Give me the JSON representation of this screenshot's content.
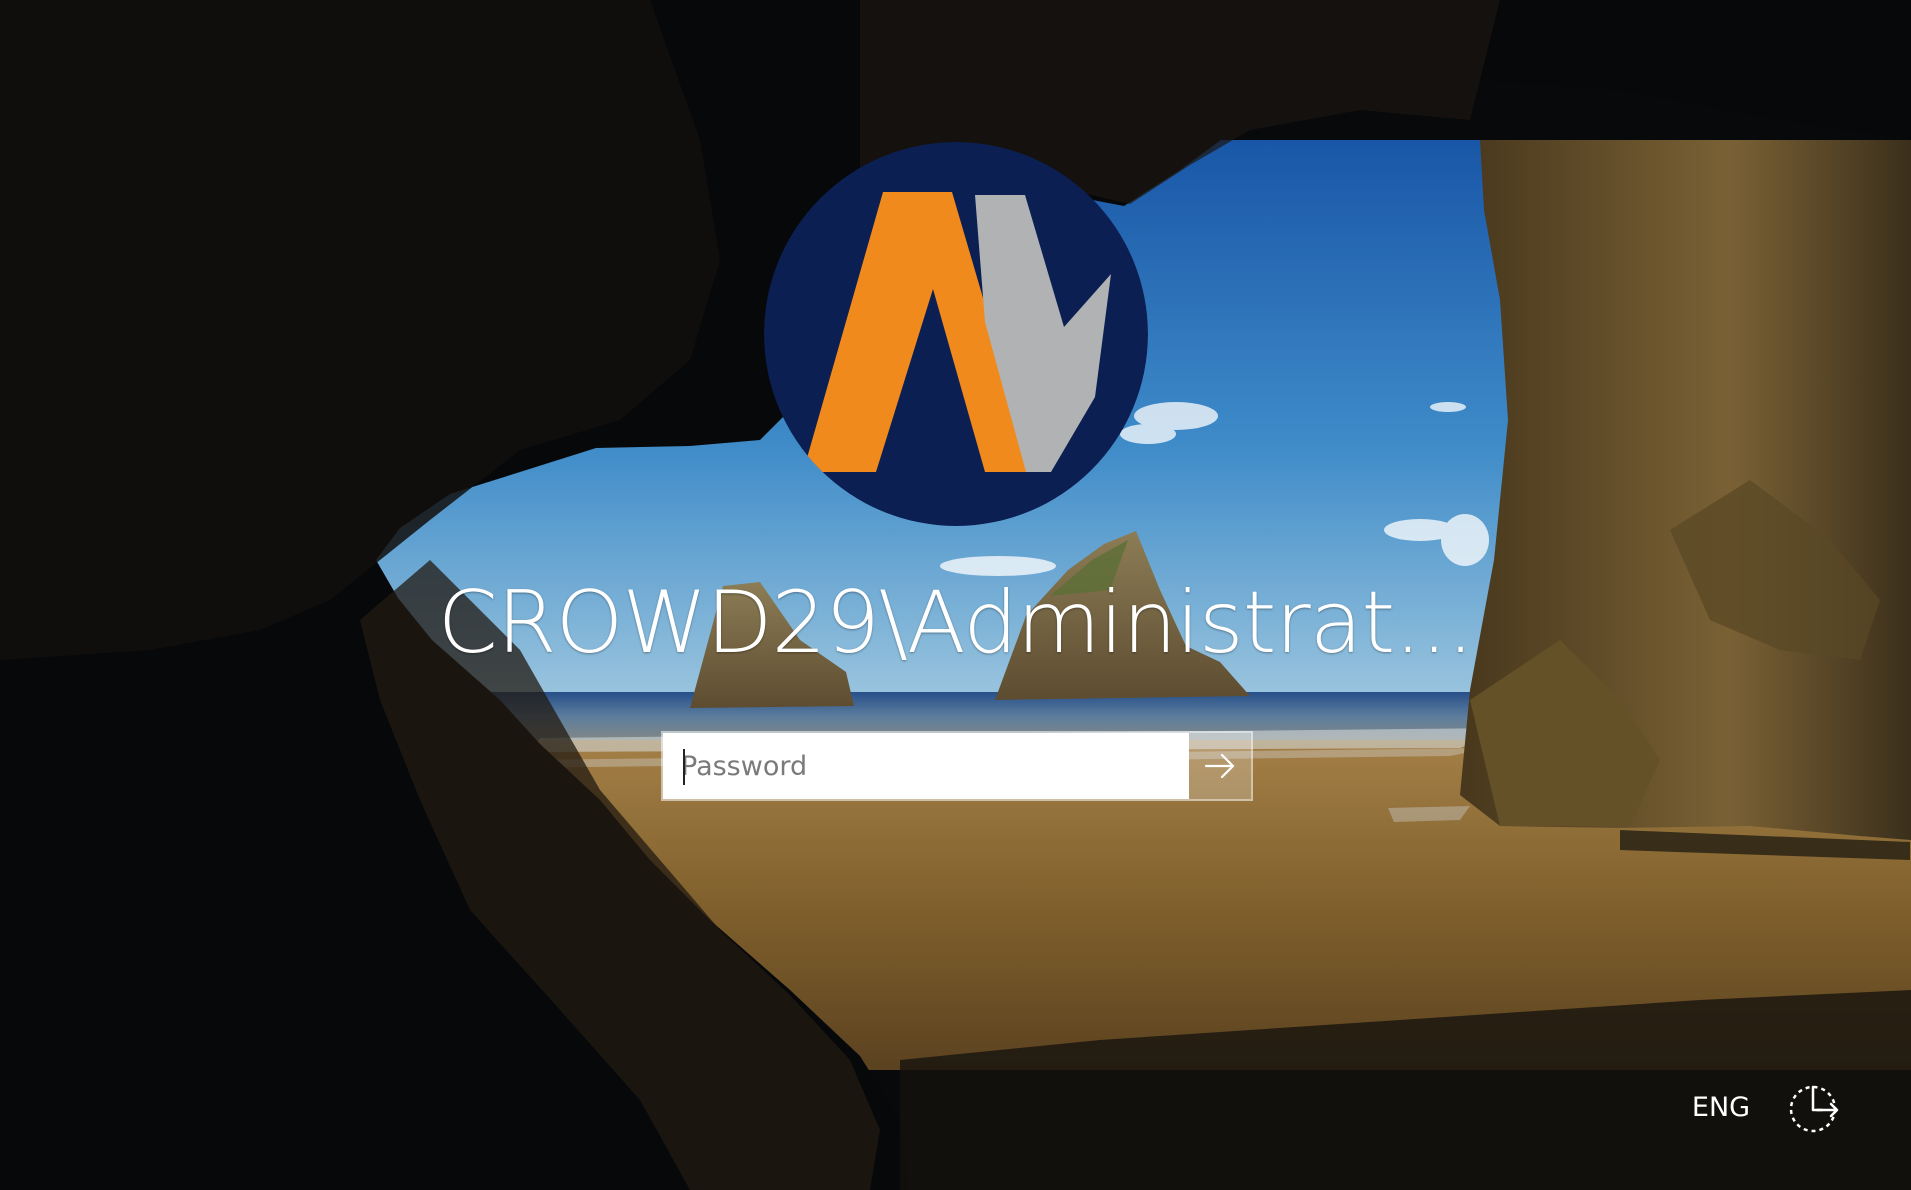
{
  "login": {
    "username": "CROWD29\\Administrat...",
    "password_placeholder": "Password"
  },
  "footer": {
    "language": "ENG"
  },
  "icons": {
    "avatar": "av-logo-icon",
    "submit": "arrow-right-icon",
    "accessibility": "ease-of-access-icon"
  },
  "colors": {
    "avatar_background": "#0c1f53",
    "logo_orange": "#f08a1c",
    "logo_gray": "#b0b2b4",
    "sky_blue": "#2f76bd",
    "beach_sand": "#8f6930"
  }
}
